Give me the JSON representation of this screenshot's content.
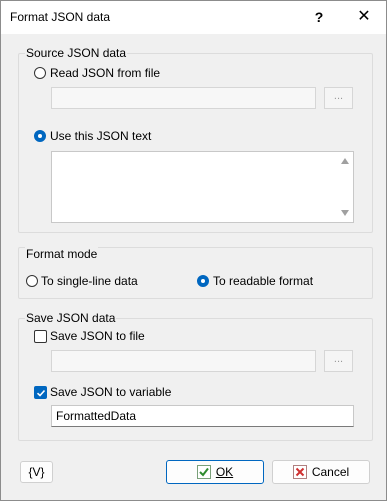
{
  "window": {
    "title": "Format JSON data",
    "help_label": "?",
    "close_label": "✕"
  },
  "source": {
    "legend": "Source JSON data",
    "read_file_label": "Read JSON from file",
    "file_path_value": "",
    "browse_label": "...",
    "use_text_label": "Use this JSON text",
    "json_text_value": "",
    "selected": "use_text"
  },
  "format_mode": {
    "legend": "Format mode",
    "single_line_label": "To single-line data",
    "readable_label": "To readable format",
    "selected": "readable"
  },
  "save": {
    "legend": "Save JSON data",
    "to_file_label": "Save JSON to file",
    "to_file_checked": false,
    "file_path_value": "",
    "browse_label": "...",
    "to_variable_label": "Save JSON to variable",
    "to_variable_checked": true,
    "variable_value": "FormattedData"
  },
  "footer": {
    "variables_button": "{V}",
    "ok_label": "OK",
    "cancel_label": "Cancel"
  },
  "colors": {
    "accent": "#0067c0",
    "ok_icon": "#2e8b2e",
    "cancel_icon": "#d03030"
  }
}
